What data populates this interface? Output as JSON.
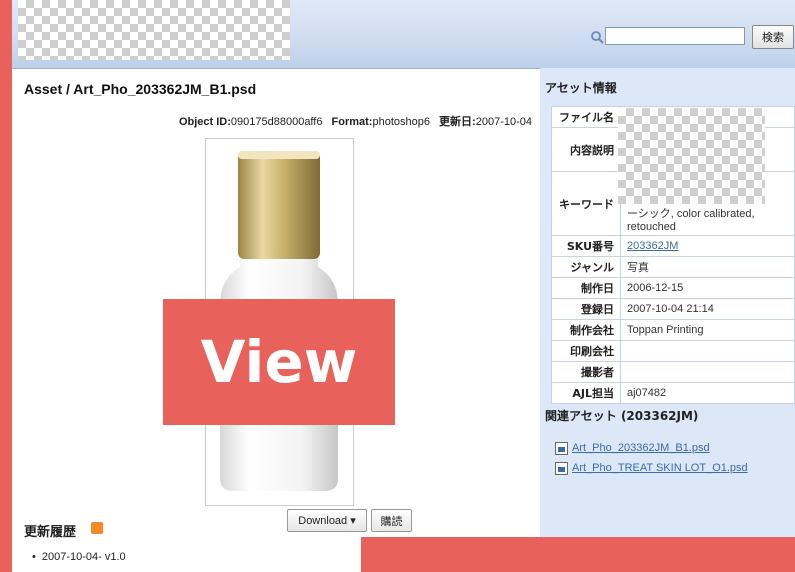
{
  "header": {
    "search_placeholder": "",
    "search_button": "検索"
  },
  "asset": {
    "title": "Asset / Art_Pho_203362JM_B1.psd",
    "object_id_label": "Object ID:",
    "object_id": "090175d88000aff6",
    "format_label": "Format:",
    "format": "photoshop6",
    "updated_label": "更新日:",
    "updated": "2007-10-04"
  },
  "actions": {
    "download": "Download ▾",
    "subscribe": "購読"
  },
  "history": {
    "title": "更新履歴",
    "items": [
      "2007-10-04- v1.0"
    ]
  },
  "sidebar": {
    "title": "アセット情報",
    "rows": [
      {
        "key": "ファイル名",
        "value": ""
      },
      {
        "key": "内容説明",
        "value": ""
      },
      {
        "key": "キーワード",
        "value": "ーシック, color calibrated, retouched"
      },
      {
        "key": "SKU番号",
        "value": "203362JM",
        "link": true
      },
      {
        "key": "ジャンル",
        "value": "写真"
      },
      {
        "key": "制作日",
        "value": "2006-12-15"
      },
      {
        "key": "登録日",
        "value": "2007-10-04 21:14"
      },
      {
        "key": "制作会社",
        "value": "Toppan Printing"
      },
      {
        "key": "印刷会社",
        "value": ""
      },
      {
        "key": "撮影者",
        "value": ""
      },
      {
        "key": "AJL担当",
        "value": "aj07482"
      }
    ],
    "related_title": "関連アセット (203362JM)",
    "related": [
      "Art_Pho_203362JM_B1.psd",
      "Art_Pho_TREAT SKIN LOT_O1.psd"
    ]
  },
  "overlay": {
    "view": "View"
  },
  "colors": {
    "accent_red": "#e8615a",
    "sidebar_bg": "#dce8f8",
    "link": "#3b6aa8"
  }
}
